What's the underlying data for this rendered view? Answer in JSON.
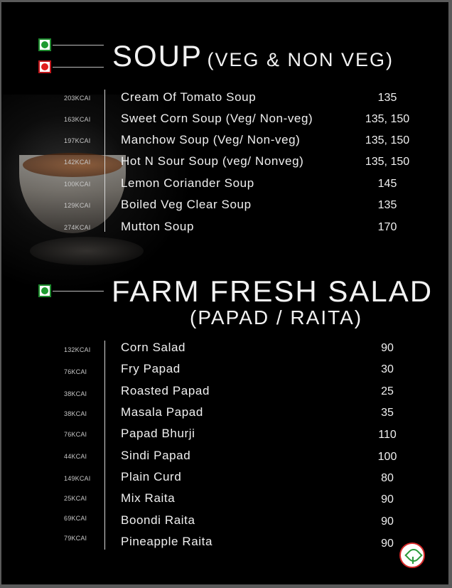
{
  "soup": {
    "title": "SOUP",
    "subtitle": "(VEG & NON VEG)",
    "marks": [
      {
        "type": "veg",
        "icon": "veg-mark-icon"
      },
      {
        "type": "nonveg",
        "icon": "non-veg-mark-icon"
      }
    ],
    "items": [
      {
        "kcal": "203KCAI",
        "name": "Cream Of Tomato Soup",
        "price": "135"
      },
      {
        "kcal": "163KCAI",
        "name": "Sweet Corn Soup (Veg/ Non-veg)",
        "price": "135, 150"
      },
      {
        "kcal": "197KCAI",
        "name": "Manchow Soup (Veg/ Non-veg)",
        "price": "135, 150"
      },
      {
        "kcal": "142KCAI",
        "name": "Hot N Sour Soup (veg/ Nonveg)",
        "price": "135, 150"
      },
      {
        "kcal": "100KCAI",
        "name": "Lemon Coriander Soup",
        "price": "145"
      },
      {
        "kcal": "129KCAI",
        "name": "Boiled Veg Clear Soup",
        "price": "135"
      },
      {
        "kcal": "274KCAI",
        "name": "Mutton Soup",
        "price": "170"
      }
    ]
  },
  "salad": {
    "title": "FARM FRESH SALAD",
    "subtitle": "(PAPAD / RAITA)",
    "marks": [
      {
        "type": "veg",
        "icon": "veg-mark-icon"
      }
    ],
    "items": [
      {
        "kcal": "132KCAI",
        "name": "Corn Salad",
        "price": "90"
      },
      {
        "kcal": "76KCAI",
        "name": "Fry Papad",
        "price": "30"
      },
      {
        "kcal": "38KCAI",
        "name": "Roasted Papad",
        "price": "25"
      },
      {
        "kcal": "38KCAI",
        "name": "Masala Papad",
        "price": "35"
      },
      {
        "kcal": "76KCAI",
        "name": "Papad Bhurji",
        "price": "110"
      },
      {
        "kcal": "44KCAI",
        "name": "Sindi Papad",
        "price": "100"
      },
      {
        "kcal": "149KCAI",
        "name": "Plain Curd",
        "price": "80"
      },
      {
        "kcal": "25KCAI",
        "name": "Mix Raita",
        "price": "90"
      },
      {
        "kcal": "69KCAI",
        "name": "Boondi Raita",
        "price": "90"
      },
      {
        "kcal": "79KCAI",
        "name": "Pineapple Raita",
        "price": "90"
      }
    ]
  },
  "colors": {
    "background": "#000000",
    "text": "#f0f0f0",
    "veg": "#1e9a30",
    "nonveg": "#e01f1f"
  },
  "images": {
    "soup_bowl": "soup-bowl-photo",
    "logo": "restaurant-logo-icon"
  }
}
